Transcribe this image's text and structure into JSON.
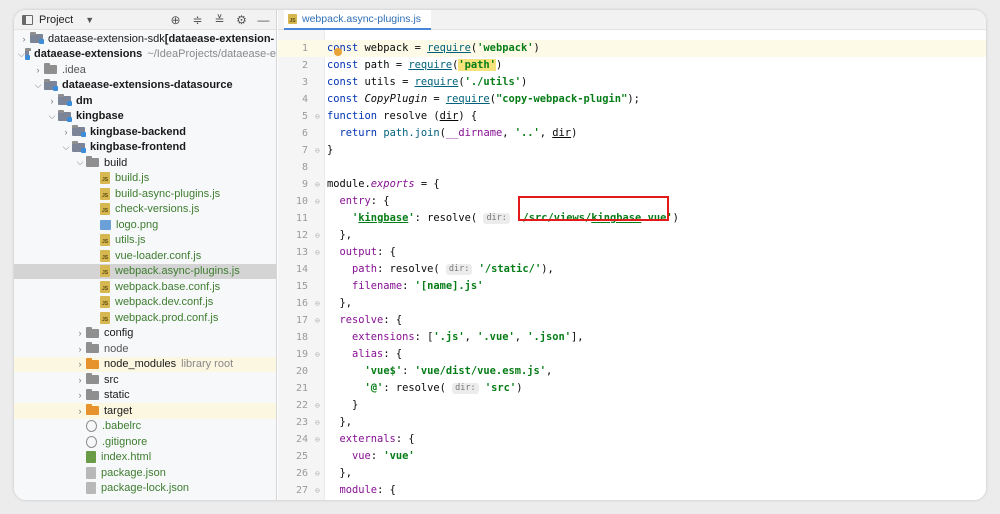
{
  "project_panel": {
    "title": "Project",
    "tree": [
      {
        "label": "dataease-extension-sdk",
        "suffix": " [dataease-extension-",
        "indent": 0,
        "arrow": "right",
        "type": "mod",
        "style": "plain"
      },
      {
        "label": "dataease-extensions",
        "suffix": " ~/IdeaProjects/dataease-e",
        "indent": 0,
        "arrow": "down",
        "type": "mod",
        "style": "bold"
      },
      {
        "label": ".idea",
        "indent": 1,
        "arrow": "right",
        "type": "folder",
        "style": "grey"
      },
      {
        "label": "dataease-extensions-datasource",
        "indent": 1,
        "arrow": "down",
        "type": "mod",
        "style": "bold"
      },
      {
        "label": "dm",
        "indent": 2,
        "arrow": "right",
        "type": "mod",
        "style": "bold"
      },
      {
        "label": "kingbase",
        "indent": 2,
        "arrow": "down",
        "type": "mod",
        "style": "bold"
      },
      {
        "label": "kingbase-backend",
        "indent": 3,
        "arrow": "right",
        "type": "mod",
        "style": "bold"
      },
      {
        "label": "kingbase-frontend",
        "indent": 3,
        "arrow": "down",
        "type": "mod",
        "style": "bold"
      },
      {
        "label": "build",
        "indent": 4,
        "arrow": "down",
        "type": "folder",
        "style": "plain"
      },
      {
        "label": "build.js",
        "indent": 5,
        "arrow": "none",
        "type": "js",
        "style": "green"
      },
      {
        "label": "build-async-plugins.js",
        "indent": 5,
        "arrow": "none",
        "type": "js",
        "style": "green"
      },
      {
        "label": "check-versions.js",
        "indent": 5,
        "arrow": "none",
        "type": "js",
        "style": "green"
      },
      {
        "label": "logo.png",
        "indent": 5,
        "arrow": "none",
        "type": "img",
        "style": "green"
      },
      {
        "label": "utils.js",
        "indent": 5,
        "arrow": "none",
        "type": "js",
        "style": "green"
      },
      {
        "label": "vue-loader.conf.js",
        "indent": 5,
        "arrow": "none",
        "type": "js",
        "style": "green"
      },
      {
        "label": "webpack.async-plugins.js",
        "indent": 5,
        "arrow": "none",
        "type": "js",
        "style": "green",
        "selected": true
      },
      {
        "label": "webpack.base.conf.js",
        "indent": 5,
        "arrow": "none",
        "type": "js",
        "style": "green"
      },
      {
        "label": "webpack.dev.conf.js",
        "indent": 5,
        "arrow": "none",
        "type": "js",
        "style": "green"
      },
      {
        "label": "webpack.prod.conf.js",
        "indent": 5,
        "arrow": "none",
        "type": "js",
        "style": "green"
      },
      {
        "label": "config",
        "indent": 4,
        "arrow": "right",
        "type": "folder",
        "style": "plain"
      },
      {
        "label": "node",
        "indent": 4,
        "arrow": "right",
        "type": "folder",
        "style": "grey"
      },
      {
        "label": "node_modules",
        "suffix": "library root",
        "indent": 4,
        "arrow": "right",
        "type": "orange",
        "style": "plain",
        "ignored": true
      },
      {
        "label": "src",
        "indent": 4,
        "arrow": "right",
        "type": "folder",
        "style": "plain"
      },
      {
        "label": "static",
        "indent": 4,
        "arrow": "right",
        "type": "folder",
        "style": "plain"
      },
      {
        "label": "target",
        "indent": 4,
        "arrow": "right",
        "type": "orange",
        "style": "plain",
        "ignored": true
      },
      {
        "label": ".babelrc",
        "indent": 4,
        "arrow": "none",
        "type": "cfg",
        "style": "green"
      },
      {
        "label": ".gitignore",
        "indent": 4,
        "arrow": "none",
        "type": "cfg",
        "style": "green"
      },
      {
        "label": "index.html",
        "indent": 4,
        "arrow": "none",
        "type": "html",
        "style": "green"
      },
      {
        "label": "package.json",
        "indent": 4,
        "arrow": "none",
        "type": "json",
        "style": "green"
      },
      {
        "label": "package-lock.json",
        "indent": 4,
        "arrow": "none",
        "type": "json",
        "style": "green"
      }
    ]
  },
  "editor": {
    "tab_label": "webpack.async-plugins.js",
    "lines": [
      {
        "n": "1",
        "html": "<span class=\"kw\">const</span> webpack = <span class=\"fn ul\">require</span>(<span class=\"str\">'webpack'</span>)"
      },
      {
        "n": "2",
        "html": "<span class=\"kw\">const</span> path = <span class=\"fn ul\">require</span>(<span class=\"str hlstr\">'path'</span>)"
      },
      {
        "n": "3",
        "html": "<span class=\"kw\">const</span> utils = <span class=\"fn ul\">require</span>(<span class=\"str\">'./utils'</span>)"
      },
      {
        "n": "4",
        "html": "<span class=\"kw\">const</span> <span class=\"it\">CopyPlugin</span> = <span class=\"fn ul\">require</span>(<span class=\"str\">\"copy-webpack-plugin\"</span>);"
      },
      {
        "n": "5",
        "html": "<span class=\"kw\">function</span> resolve (<span class=\"ul\">dir</span>) {"
      },
      {
        "n": "6",
        "html": "  <span class=\"kw\">return</span> <span class=\"fn\">path.join</span>(<span class=\"pn\">__dirname</span>, <span class=\"str\">'..'</span>, <span class=\"ul\">dir</span>)"
      },
      {
        "n": "7",
        "html": "}"
      },
      {
        "n": "8",
        "html": ""
      },
      {
        "n": "9",
        "html": "module.<span class=\"pn it\">exports</span> = {"
      },
      {
        "n": "10",
        "html": "  <span class=\"pn\">entry</span>: {"
      },
      {
        "n": "11",
        "html": "    <span class=\"str\">'<span class=\"ul\">kingbase</span>'</span>: resolve( <span class=\"hint\">dir:</span> <span class=\"str\">'/src/views/<span class=\"ul\">kingbase</span>.vue'</span>)"
      },
      {
        "n": "12",
        "html": "  },"
      },
      {
        "n": "13",
        "html": "  <span class=\"pn\">output</span>: {"
      },
      {
        "n": "14",
        "html": "    <span class=\"pn\">path</span>: resolve( <span class=\"hint\">dir:</span> <span class=\"str\">'/static/'</span>),"
      },
      {
        "n": "15",
        "html": "    <span class=\"pn\">filename</span>: <span class=\"str\">'[name].js'</span>"
      },
      {
        "n": "16",
        "html": "  },"
      },
      {
        "n": "17",
        "html": "  <span class=\"pn\">resolve</span>: {"
      },
      {
        "n": "18",
        "html": "    <span class=\"pn\">extensions</span>: [<span class=\"str\">'.js'</span>, <span class=\"str\">'.vue'</span>, <span class=\"str\">'.json'</span>],"
      },
      {
        "n": "19",
        "html": "    <span class=\"pn\">alias</span>: {"
      },
      {
        "n": "20",
        "html": "      <span class=\"str\">'vue$'</span>: <span class=\"str\">'vue/dist/vue.esm.js'</span>,"
      },
      {
        "n": "21",
        "html": "      <span class=\"str\">'@'</span>: resolve( <span class=\"hint\">dir:</span> <span class=\"str\">'src'</span>)"
      },
      {
        "n": "22",
        "html": "    }"
      },
      {
        "n": "23",
        "html": "  },"
      },
      {
        "n": "24",
        "html": "  <span class=\"pn\">externals</span>: {"
      },
      {
        "n": "25",
        "html": "    <span class=\"pn\">vue</span>: <span class=\"str\">'vue'</span>"
      },
      {
        "n": "26",
        "html": "  },"
      },
      {
        "n": "27",
        "html": "  <span class=\"pn\">module</span>: {"
      }
    ]
  }
}
